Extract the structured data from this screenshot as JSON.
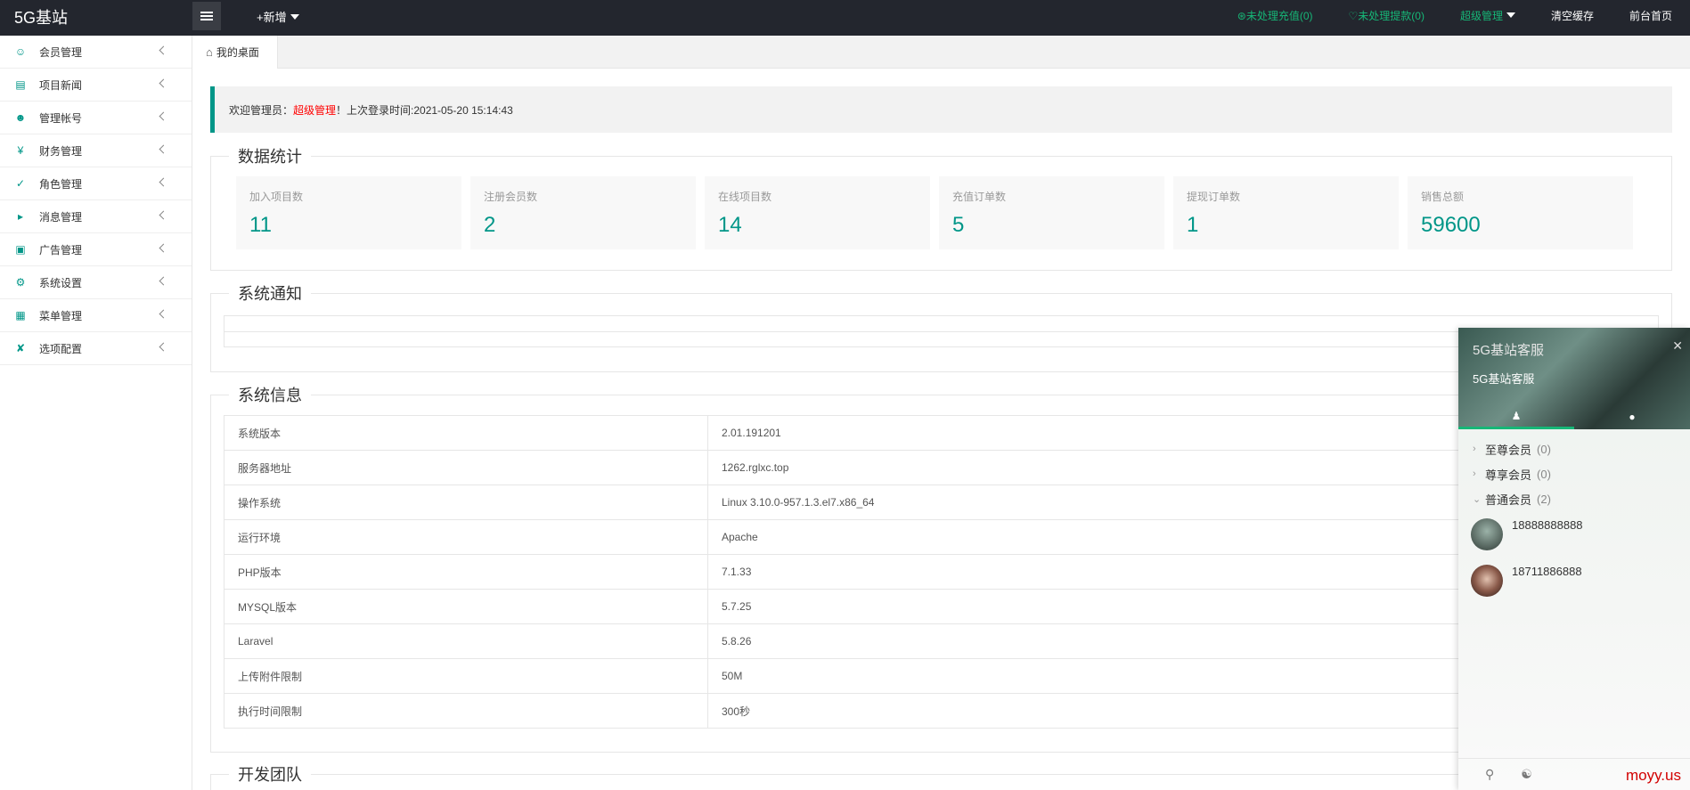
{
  "topbar": {
    "logo": "5G基站",
    "new_label": "+新增",
    "pending_recharge": "⊛未处理充值(0)",
    "pending_withdraw": "♡未处理提款(0)",
    "admin_label": "超级管理",
    "clear_cache": "清空缓存",
    "front_home": "前台首页"
  },
  "sidebar": {
    "items": [
      {
        "label": "会员管理",
        "icon": "user-icon"
      },
      {
        "label": "项目新闻",
        "icon": "book-icon"
      },
      {
        "label": "管理帐号",
        "icon": "users-icon"
      },
      {
        "label": "财务管理",
        "icon": "yen-icon"
      },
      {
        "label": "角色管理",
        "icon": "shield-icon"
      },
      {
        "label": "消息管理",
        "icon": "speaker-icon"
      },
      {
        "label": "广告管理",
        "icon": "image-icon"
      },
      {
        "label": "系统设置",
        "icon": "gear-icon"
      },
      {
        "label": "菜单管理",
        "icon": "grid-icon"
      },
      {
        "label": "选项配置",
        "icon": "tool-icon"
      }
    ]
  },
  "tabs": {
    "desktop": "我的桌面"
  },
  "welcome": {
    "prefix": "欢迎管理员：",
    "name": "超级管理",
    "suffix": "！上次登录时间:2021-05-20 15:14:43"
  },
  "stats": {
    "title": "数据统计",
    "items": [
      {
        "label": "加入项目数",
        "value": "11"
      },
      {
        "label": "注册会员数",
        "value": "2"
      },
      {
        "label": "在线项目数",
        "value": "14"
      },
      {
        "label": "充值订单数",
        "value": "5"
      },
      {
        "label": "提现订单数",
        "value": "1"
      },
      {
        "label": "销售总额",
        "value": "59600"
      }
    ]
  },
  "notice": {
    "title": "系统通知"
  },
  "sysinfo": {
    "title": "系统信息",
    "rows": [
      {
        "k": "系统版本",
        "v": "2.01.191201"
      },
      {
        "k": "服务器地址",
        "v": "1262.rglxc.top"
      },
      {
        "k": "操作系统",
        "v": "Linux 3.10.0-957.1.3.el7.x86_64"
      },
      {
        "k": "运行环境",
        "v": "Apache"
      },
      {
        "k": "PHP版本",
        "v": "7.1.33"
      },
      {
        "k": "MYSQL版本",
        "v": "5.7.25"
      },
      {
        "k": "Laravel",
        "v": "5.8.26"
      },
      {
        "k": "上传附件限制",
        "v": "50M"
      },
      {
        "k": "执行时间限制",
        "v": "300秒"
      }
    ]
  },
  "team": {
    "title": "开发团队"
  },
  "chat": {
    "title": "5G基站客服",
    "subtitle": "5G基站客服",
    "groups": [
      {
        "name": "至尊会员",
        "count": "(0)"
      },
      {
        "name": "尊享会员",
        "count": "(0)"
      },
      {
        "name": "普通会员",
        "count": "(2)"
      }
    ],
    "users": [
      {
        "name": "18888888888"
      },
      {
        "name": "18711886888"
      }
    ]
  },
  "watermark": "moyy.us",
  "colors": {
    "accent": "#009688",
    "topbar": "#23262e",
    "status_green": "#16b777",
    "highlight_red": "#ff0000"
  }
}
